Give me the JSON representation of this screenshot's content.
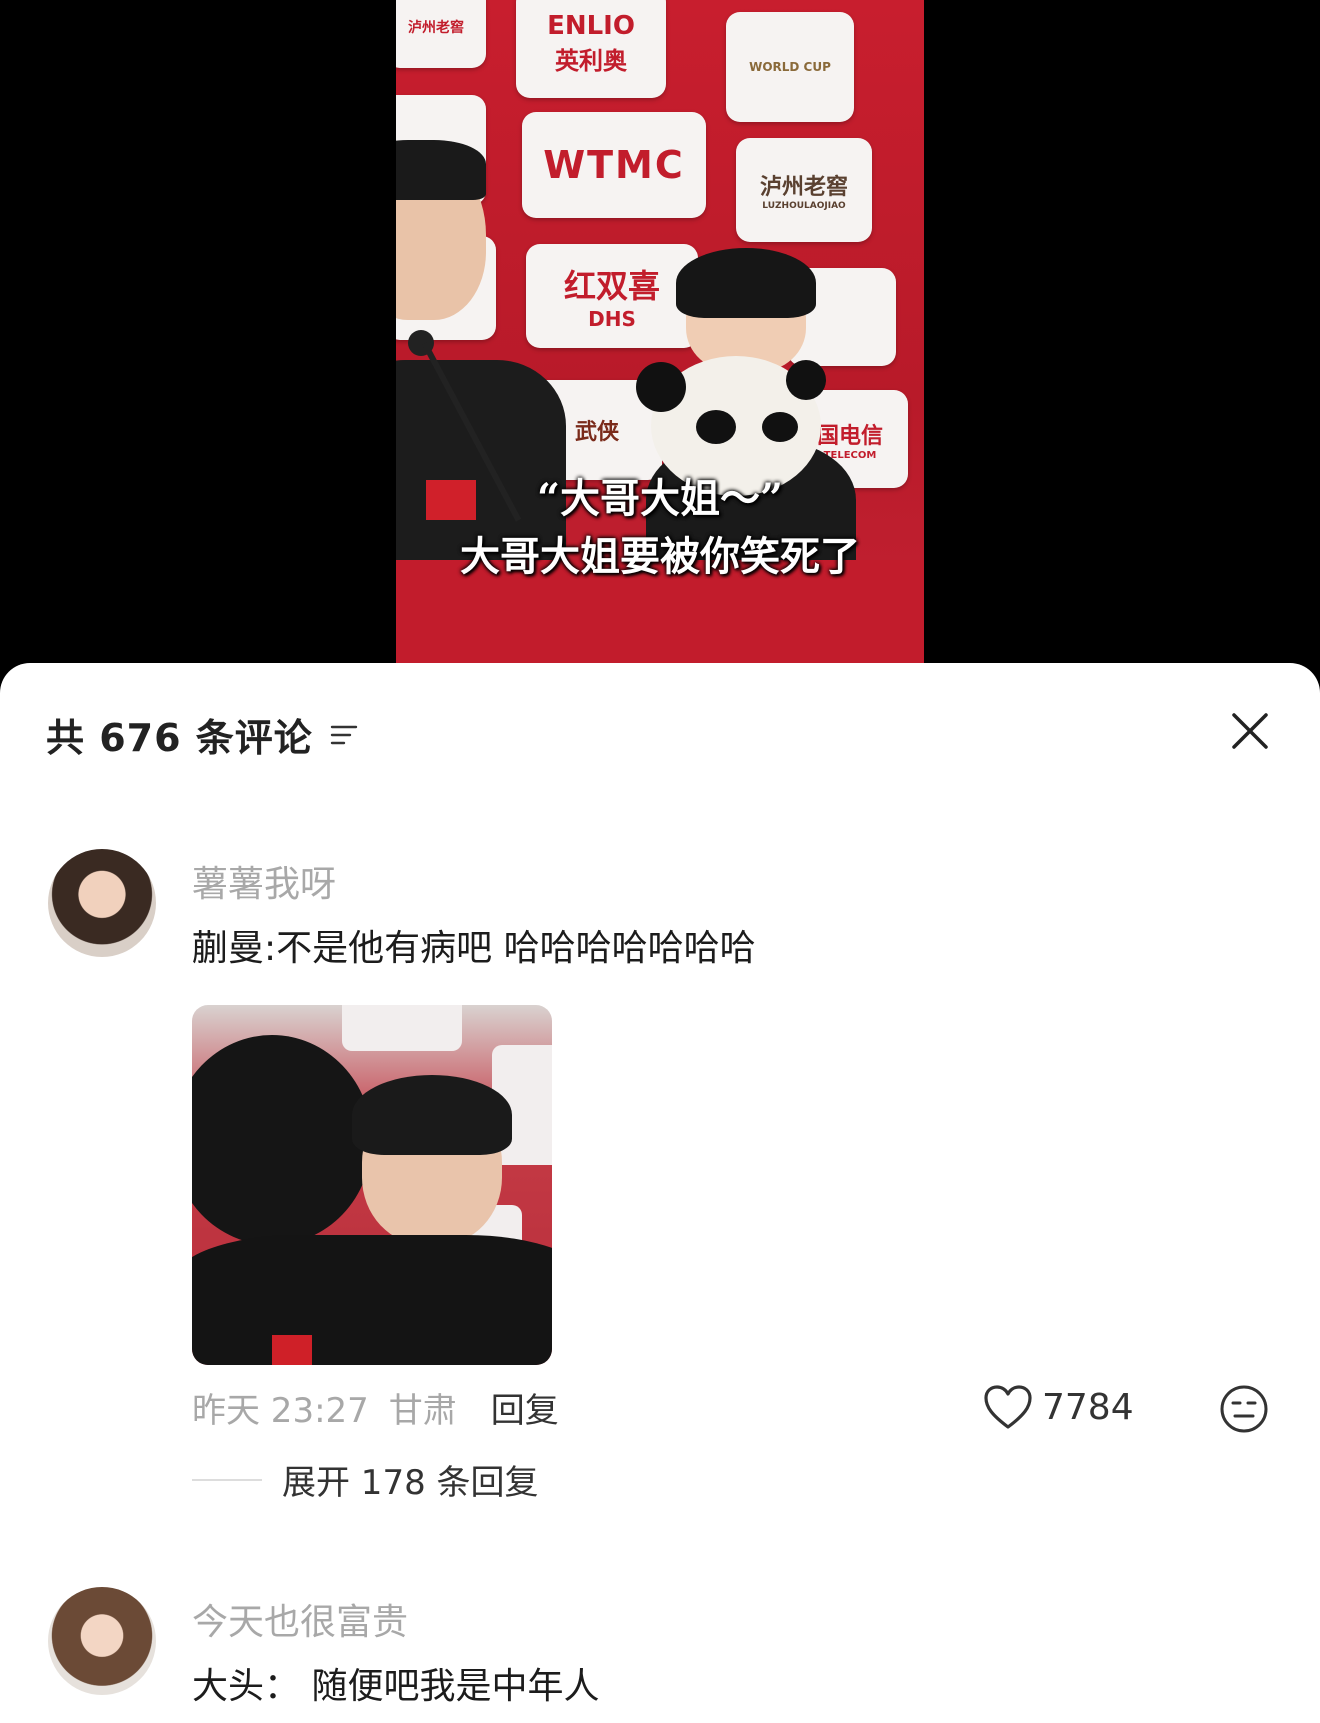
{
  "video": {
    "caption_line1": "“大哥大姐～”",
    "caption_line2": "大哥大姐要被你笑死了",
    "sponsors": [
      "ENLIO",
      "英利奥",
      "WTMC",
      "红双喜",
      "DHS",
      "泸州老窖",
      "LUZHOULAOJIAO",
      "WORLD CUP",
      "武侠",
      "国电信",
      "TELECOM"
    ]
  },
  "sheet": {
    "count_label": "共 676 条评论",
    "filter_icon": "filter-icon",
    "close_icon": "close-icon"
  },
  "comments": [
    {
      "username": "薯薯我呀",
      "text": "蒯曼:不是他有病吧 哈哈哈哈哈哈哈",
      "time": "昨天 23:27",
      "location": "甘肃",
      "reply_label": "回复",
      "likes": "7784",
      "expand_label": "展开 178 条回复"
    },
    {
      "username": "今天也很富贵",
      "text": "大头：  随便吧我是中年人"
    }
  ],
  "colors": {
    "backdrop_red": "#c81e2e",
    "muted_text": "#a8a8a8",
    "body_text": "#1c1c1c"
  }
}
